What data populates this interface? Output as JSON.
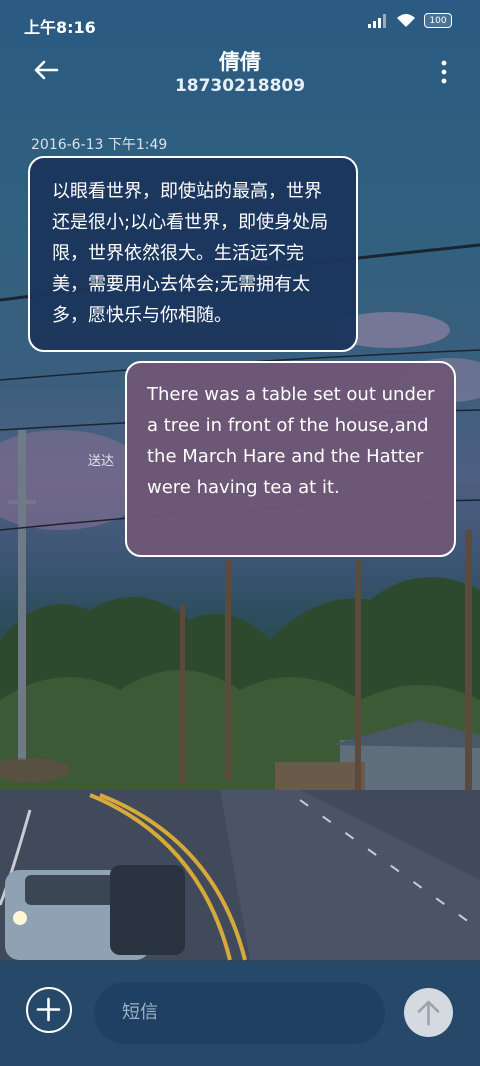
{
  "status": {
    "time": "上午8:16",
    "battery": "100"
  },
  "header": {
    "title": "倩倩",
    "subtitle": "18730218809",
    "back_icon": "arrow-left-icon",
    "menu_icon": "more-vertical-icon"
  },
  "messages": [
    {
      "date": "2016-6-13 下午1:49",
      "text": "以眼看世界，即使站的最高，世界还是很小;以心看世界，即使身处局限，世界依然很大。生活远不完美，需要用心去体会;无需拥有太多，愿快乐与你相随。"
    },
    {
      "text": "There was a table set out under a tree in front of the house,and the March Hare and the Hatter were having tea at it.",
      "status": "送达"
    }
  ],
  "composer": {
    "placeholder": "短信",
    "add_icon": "plus-circle-icon",
    "send_icon": "arrow-up-icon"
  }
}
